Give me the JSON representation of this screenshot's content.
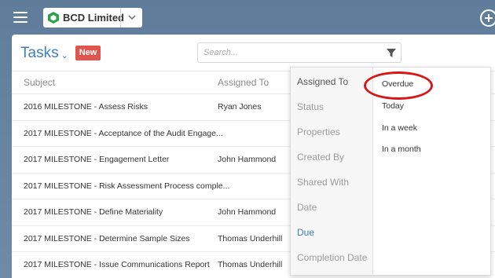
{
  "topbar": {
    "company_name": "BCD Limited",
    "icons": [
      "menu-icon",
      "company-hex-icon",
      "chevron-down-icon",
      "add-circle-icon"
    ],
    "accent_color": "#2aa34a"
  },
  "page": {
    "title": "Tasks",
    "title_chevron": "⌄",
    "new_label": "New",
    "search_placeholder": "Search..."
  },
  "columns": {
    "subject": "Subject",
    "assigned_to": "Assigned To"
  },
  "tasks": [
    {
      "subject": "2016 MILESTONE - Assess Risks",
      "assigned": "Ryan Jones"
    },
    {
      "subject": "2017 MILESTONE - Acceptance of the Audit Engage...",
      "assigned": ""
    },
    {
      "subject": "2017 MILESTONE - Engagement Letter",
      "assigned": "John Hammond"
    },
    {
      "subject": "2017 MILESTONE - Risk Assessment Process comple...",
      "assigned": ""
    },
    {
      "subject": "2017 MILESTONE - Define Materiality",
      "assigned": "John Hammond"
    },
    {
      "subject": "2017 MILESTONE - Determine Sample Sizes",
      "assigned": "Thomas Underhill"
    },
    {
      "subject": "2017 MILESTONE - Issue Communications Report",
      "assigned": "Thomas Underhill"
    }
  ],
  "filter_menu": {
    "categories": [
      "Assigned To",
      "Status",
      "Properties",
      "Created By",
      "Shared With",
      "Date",
      "Due",
      "Completion Date"
    ],
    "active_category": "Due",
    "options": [
      "Overdue",
      "Today",
      "In a week",
      "In a month"
    ],
    "highlighted_option": "Overdue",
    "highlight_color": "#d81717",
    "link_color": "#3d7fc1"
  }
}
